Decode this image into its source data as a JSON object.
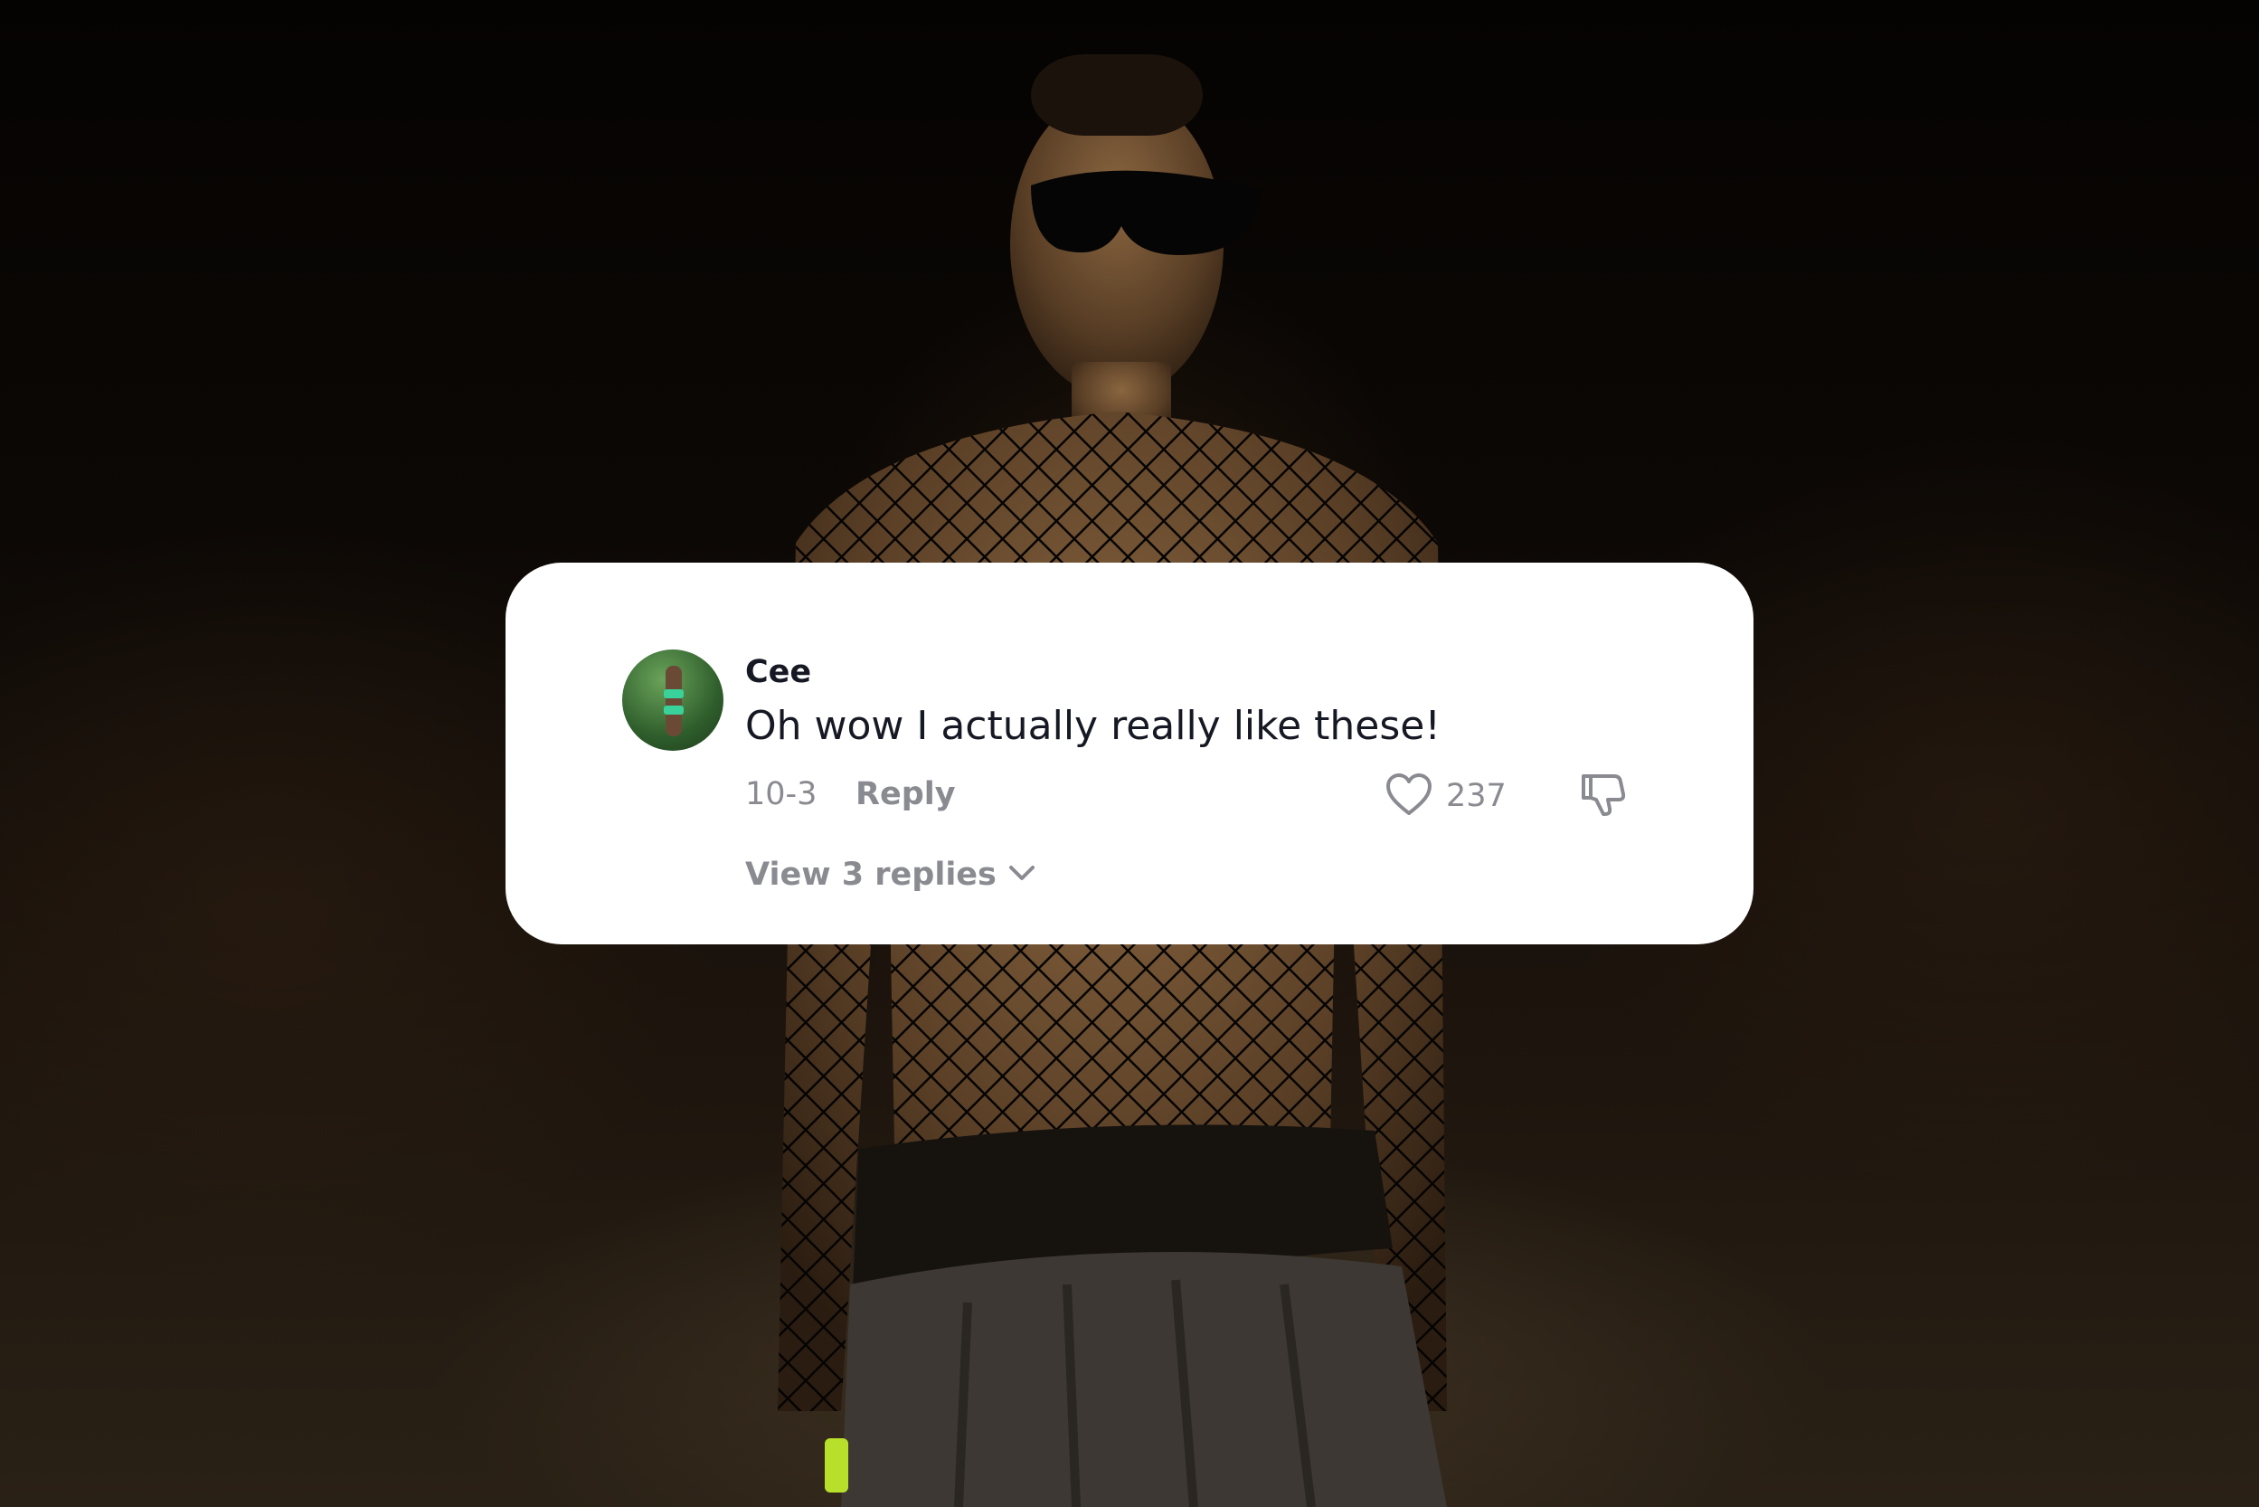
{
  "comment": {
    "username": "Cee",
    "text": "Oh wow I actually really like these!",
    "date": "10-3",
    "reply_label": "Reply",
    "like_count": "237",
    "view_replies_label": "View 3 replies",
    "avatar_icon": "user-avatar-photo"
  },
  "icons": {
    "like": "heart-icon",
    "dislike": "thumbs-down-icon",
    "expand": "chevron-down-icon"
  },
  "colors": {
    "card_background": "#ffffff",
    "primary_text": "#161823",
    "secondary_text": "#8a8b91"
  }
}
